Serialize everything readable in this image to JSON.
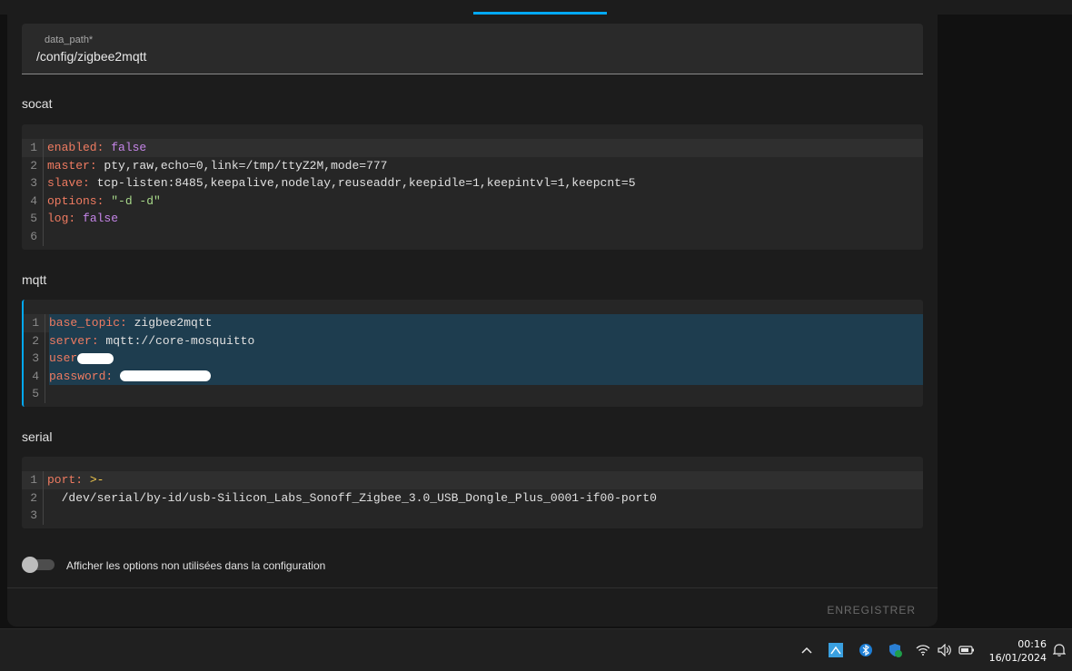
{
  "form": {
    "data_path": {
      "label": "data_path*",
      "value": "/config/zigbee2mqtt"
    }
  },
  "sections": {
    "socat": {
      "title": "socat",
      "lines": [
        {
          "n": "1",
          "key": "enabled",
          "sep": ": ",
          "value": "false",
          "value_type": "bool"
        },
        {
          "n": "2",
          "key": "master",
          "sep": ": ",
          "value": "pty,raw,echo=0,link=/tmp/ttyZ2M,mode=777",
          "value_type": "plain"
        },
        {
          "n": "3",
          "key": "slave",
          "sep": ": ",
          "value": "tcp-listen:8485,keepalive,nodelay,reuseaddr,keepidle=1,keepintvl=1,keepcnt=5",
          "value_type": "plain"
        },
        {
          "n": "4",
          "key": "options",
          "sep": ": ",
          "value": "\"-d -d\"",
          "value_type": "string"
        },
        {
          "n": "5",
          "key": "log",
          "sep": ": ",
          "value": "false",
          "value_type": "bool"
        },
        {
          "n": "6",
          "key": "",
          "sep": "",
          "value": "",
          "value_type": "plain"
        }
      ]
    },
    "mqtt": {
      "title": "mqtt",
      "lines": [
        {
          "n": "1",
          "key": "base_topic",
          "sep": ": ",
          "value": "zigbee2mqtt",
          "value_type": "plain"
        },
        {
          "n": "2",
          "key": "server",
          "sep": ": ",
          "value": "mqtt://core-mosquitto",
          "value_type": "plain"
        },
        {
          "n": "3",
          "key": "user",
          "sep": "",
          "value": "",
          "value_type": "redacted"
        },
        {
          "n": "4",
          "key": "password",
          "sep": ": ",
          "value": "",
          "value_type": "redacted"
        },
        {
          "n": "5",
          "key": "",
          "sep": "",
          "value": "",
          "value_type": "plain"
        }
      ]
    },
    "serial": {
      "title": "serial",
      "lines": [
        {
          "n": "1",
          "key": "port",
          "sep": ": ",
          "value": ">-",
          "value_type": "block"
        },
        {
          "n": "2",
          "key": "",
          "sep": "",
          "value": "  /dev/serial/by-id/usb-Silicon_Labs_Sonoff_Zigbee_3.0_USB_Dongle_Plus_0001-if00-port0",
          "value_type": "plain"
        },
        {
          "n": "3",
          "key": "",
          "sep": "",
          "value": "",
          "value_type": "plain"
        }
      ]
    }
  },
  "toggle": {
    "label": "Afficher les options non utilisées dans la configuration",
    "checked": false
  },
  "actions": {
    "save_label": "ENREGISTRER"
  },
  "taskbar": {
    "icons": [
      "chevron-up-icon",
      "network-app-icon",
      "bluetooth-icon",
      "security-shield-icon",
      "wifi-icon",
      "volume-icon",
      "battery-icon",
      "notification-bell-icon"
    ],
    "time": "00:16",
    "date": "16/01/2024"
  },
  "colors": {
    "accent": "#03a9f4",
    "yaml_key": "#ef7b61",
    "yaml_bool": "#c585e8",
    "yaml_string": "#a8d98a"
  }
}
